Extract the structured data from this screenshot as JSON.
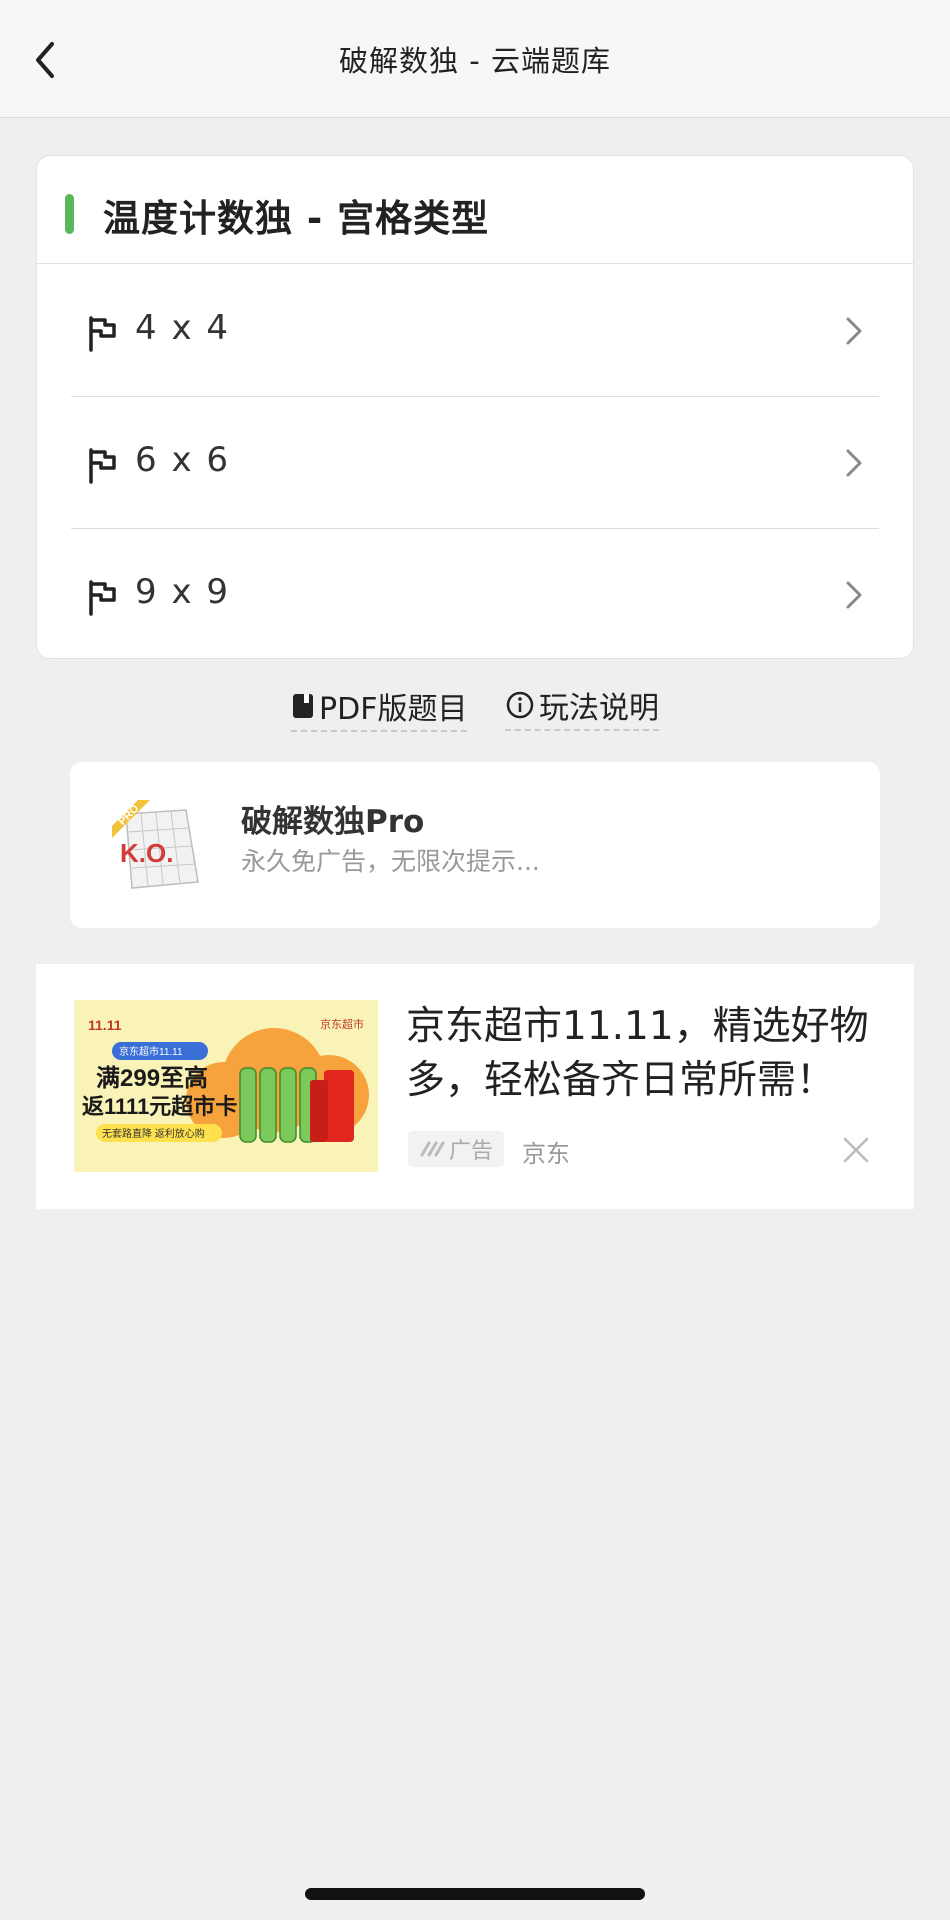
{
  "nav": {
    "title": "破解数独 - 云端题库"
  },
  "card": {
    "title": "温度计数独 - 宫格类型",
    "accent_color": "#5bb75b",
    "items": [
      {
        "label": "4 x 4"
      },
      {
        "label": "6 x 6"
      },
      {
        "label": "9 x 9"
      }
    ]
  },
  "links": {
    "pdf": "PDF版题目",
    "rules": "玩法说明"
  },
  "promo": {
    "title": "破解数独Pro",
    "subtitle": "永久免广告，无限次提示...",
    "logo_badge": "PRO",
    "logo_text": "K.O."
  },
  "ad": {
    "headline": "京东超市11.11，精选好物多，轻松备齐日常所需！",
    "badge": "广告",
    "source": "京东",
    "image": {
      "brand": "京东超市",
      "tag": "京东超市11.11",
      "line1": "满299至高",
      "line2": "返1111元超市卡",
      "line3": "无套路直降 返利放心购",
      "logo": "11.11"
    }
  }
}
